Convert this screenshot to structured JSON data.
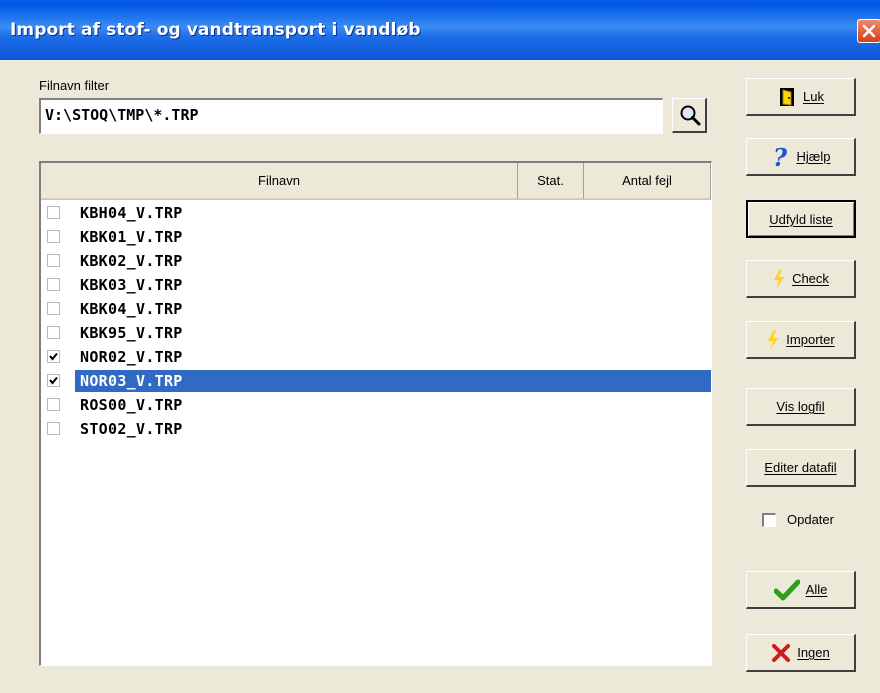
{
  "window": {
    "title": "Import af stof- og vandtransport i vandløb"
  },
  "filter": {
    "label": "Filnavn filter",
    "value": "V:\\STOQ\\TMP\\*.TRP"
  },
  "list": {
    "headers": [
      "Filnavn",
      "Stat.",
      "Antal fejl"
    ],
    "rows": [
      {
        "name": "KBH04_V.TRP",
        "checked": false
      },
      {
        "name": "KBK01_V.TRP",
        "checked": false
      },
      {
        "name": "KBK02_V.TRP",
        "checked": false
      },
      {
        "name": "KBK03_V.TRP",
        "checked": false
      },
      {
        "name": "KBK04_V.TRP",
        "checked": false
      },
      {
        "name": "KBK95_V.TRP",
        "checked": false
      },
      {
        "name": "NOR02_V.TRP",
        "checked": true
      },
      {
        "name": "NOR03_V.TRP",
        "checked": true,
        "selected": true
      },
      {
        "name": "ROS00_V.TRP",
        "checked": false
      },
      {
        "name": "STO02_V.TRP",
        "checked": false
      }
    ]
  },
  "buttons": {
    "luk": "Luk",
    "hjaelp": "Hjælp",
    "udfyld": "Udfyld liste",
    "check": "Check",
    "importer": "Importer",
    "vis_logfil": "Vis logfil",
    "editer": "Editer datafil",
    "alle": "Alle",
    "ingen": "Ingen"
  },
  "opdater": {
    "label": "Opdater",
    "checked": false
  },
  "colors": {
    "title_bar": "#0a5be5",
    "selection": "#316ac5",
    "face": "#ece9d8"
  },
  "icons": [
    "close-icon",
    "search-icon",
    "door-icon",
    "help-icon",
    "lightning-icon",
    "checkmark-icon",
    "x-icon"
  ]
}
